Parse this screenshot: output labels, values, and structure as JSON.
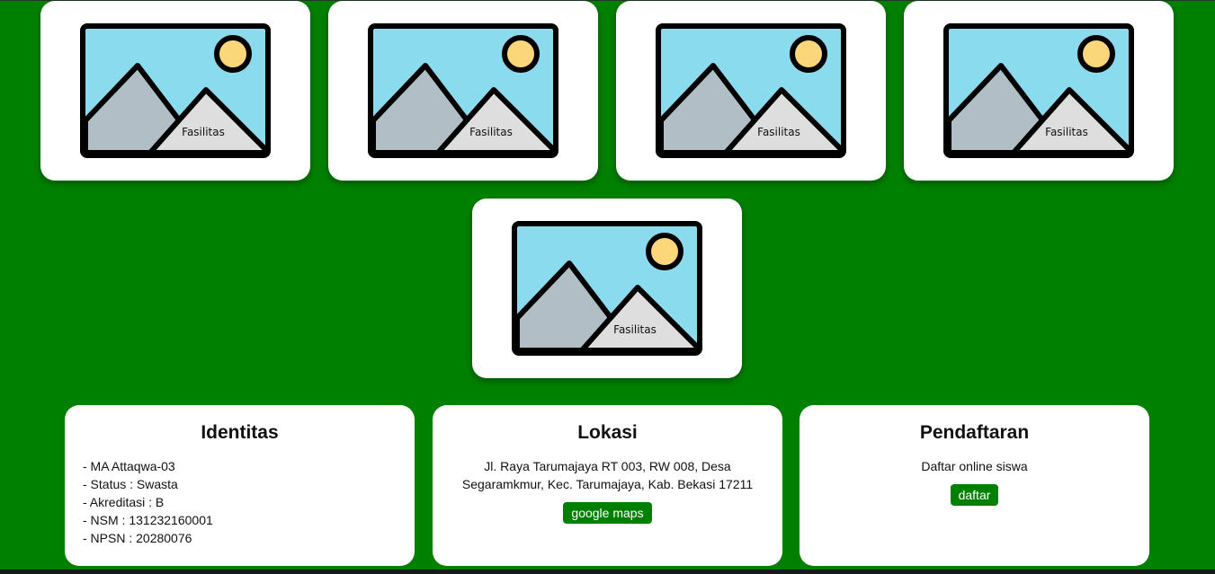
{
  "gallery": {
    "image_label": "Fasilitas",
    "count": 5
  },
  "identitas": {
    "title": "Identitas",
    "items": [
      "- MA Attaqwa-03",
      "- Status : Swasta",
      "- Akreditasi : B",
      "- NSM : 131232160001",
      "- NPSN : 20280076"
    ]
  },
  "lokasi": {
    "title": "Lokasi",
    "address": "Jl. Raya Tarumajaya RT 003, RW 008, Desa Segaramkmur, Kec. Tarumajaya, Kab. Bekasi 17211",
    "button_label": "google maps"
  },
  "pendaftaran": {
    "title": "Pendaftaran",
    "text": "Daftar online siswa",
    "button_label": "daftar"
  },
  "colors": {
    "background": "#008000",
    "card": "#ffffff",
    "button": "#008000",
    "sky": "#8adbee",
    "sun": "#fcd77a",
    "mountain_back": "#b1bec6",
    "mountain_front": "#dedede"
  }
}
